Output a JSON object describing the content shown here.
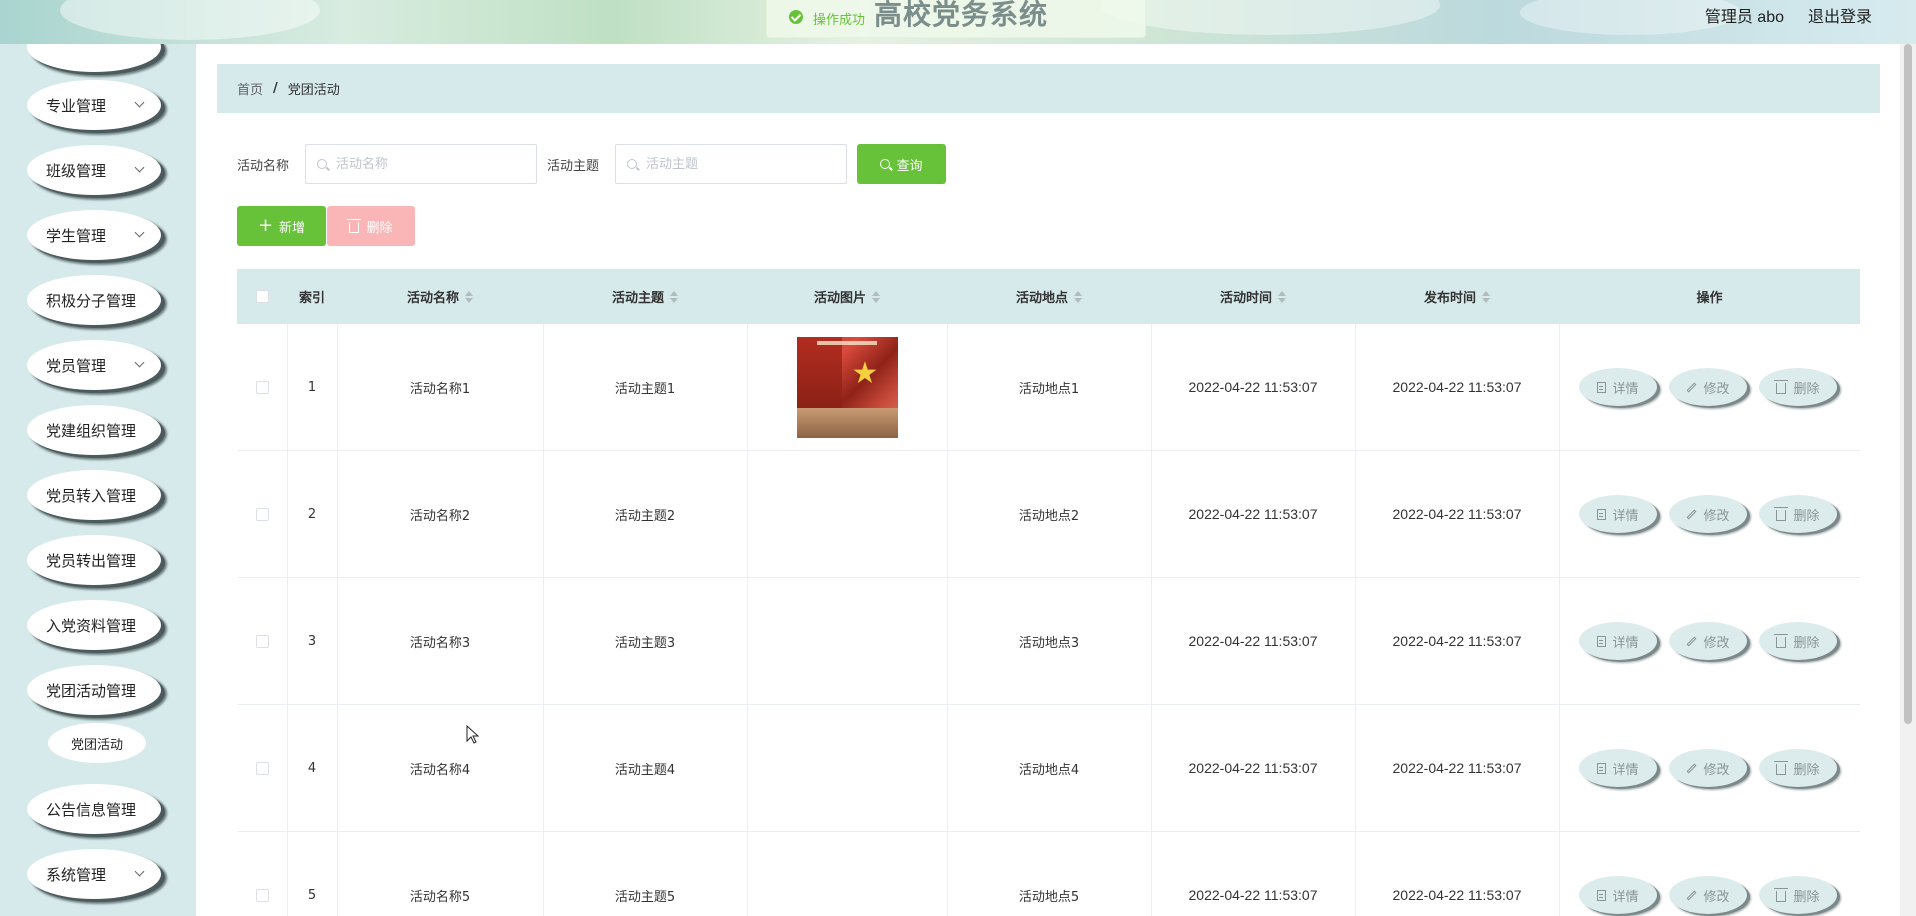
{
  "header": {
    "title": "高校党务系统",
    "user": "管理员 abo",
    "logout": "退出登录"
  },
  "toast": {
    "message": "操作成功"
  },
  "sidebar": {
    "items": [
      {
        "label": "专业管理",
        "has_children": true
      },
      {
        "label": "班级管理",
        "has_children": true
      },
      {
        "label": "学生管理",
        "has_children": true
      },
      {
        "label": "积极分子管理",
        "has_children": false
      },
      {
        "label": "党员管理",
        "has_children": true
      },
      {
        "label": "党建组织管理",
        "has_children": false
      },
      {
        "label": "党员转入管理",
        "has_children": false
      },
      {
        "label": "党员转出管理",
        "has_children": false
      },
      {
        "label": "入党资料管理",
        "has_children": false
      },
      {
        "label": "党团活动管理",
        "has_children": false
      },
      {
        "label": "公告信息管理",
        "has_children": false
      },
      {
        "label": "系统管理",
        "has_children": true
      }
    ],
    "active_sub": "党团活动"
  },
  "breadcrumb": {
    "home": "首页",
    "separator": "/",
    "current": "党团活动"
  },
  "search": {
    "name_label": "活动名称",
    "name_placeholder": "活动名称",
    "theme_label": "活动主题",
    "theme_placeholder": "活动主题",
    "query_button": "查询"
  },
  "actions": {
    "add": "新增",
    "delete": "删除"
  },
  "table": {
    "columns": [
      "索引",
      "活动名称",
      "活动主题",
      "活动图片",
      "活动地点",
      "活动时间",
      "发布时间",
      "操作"
    ],
    "rows": [
      {
        "index": "1",
        "name": "活动名称1",
        "theme": "活动主题1",
        "has_image": true,
        "place": "活动地点1",
        "time": "2022-04-22 11:53:07",
        "publish": "2022-04-22 11:53:07"
      },
      {
        "index": "2",
        "name": "活动名称2",
        "theme": "活动主题2",
        "has_image": false,
        "place": "活动地点2",
        "time": "2022-04-22 11:53:07",
        "publish": "2022-04-22 11:53:07"
      },
      {
        "index": "3",
        "name": "活动名称3",
        "theme": "活动主题3",
        "has_image": false,
        "place": "活动地点3",
        "time": "2022-04-22 11:53:07",
        "publish": "2022-04-22 11:53:07"
      },
      {
        "index": "4",
        "name": "活动名称4",
        "theme": "活动主题4",
        "has_image": false,
        "place": "活动地点4",
        "time": "2022-04-22 11:53:07",
        "publish": "2022-04-22 11:53:07"
      },
      {
        "index": "5",
        "name": "活动名称5",
        "theme": "活动主题5",
        "has_image": false,
        "place": "活动地点5",
        "time": "2022-04-22 11:53:07",
        "publish": "2022-04-22 11:53:07"
      }
    ],
    "row_actions": {
      "detail": "详情",
      "edit": "修改",
      "delete": "删除"
    }
  },
  "colors": {
    "accent": "#67c23a",
    "danger_light": "#fab6b6",
    "panel": "#d6e9eb"
  }
}
